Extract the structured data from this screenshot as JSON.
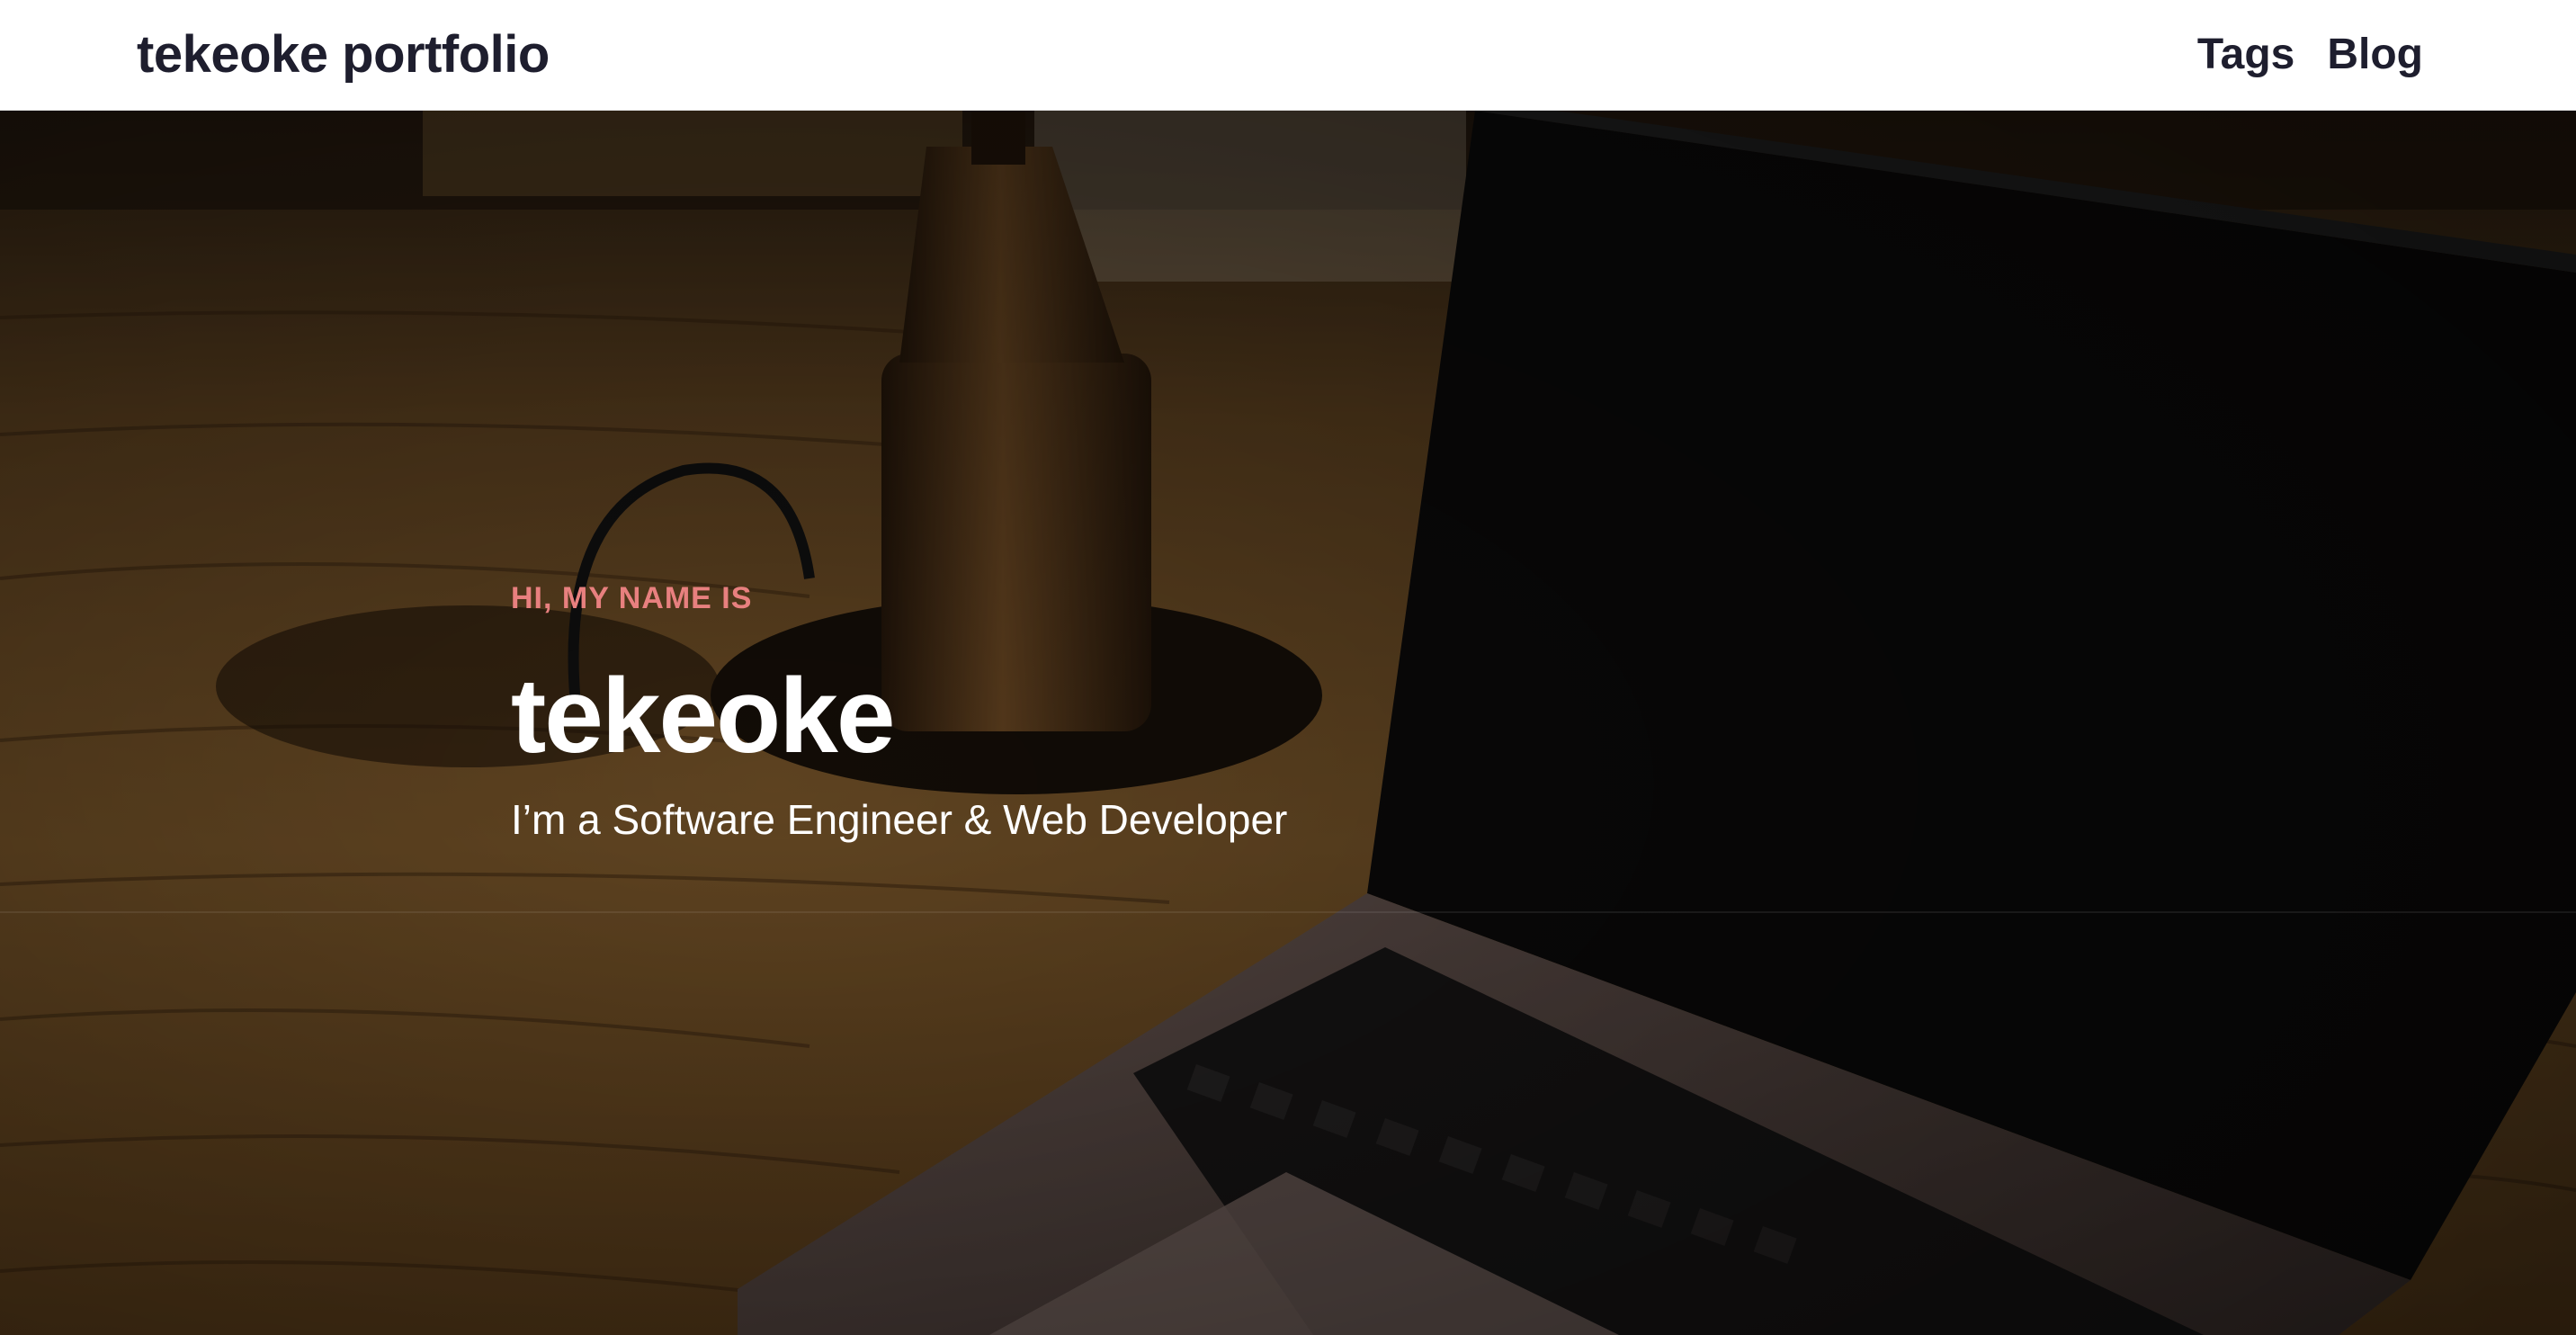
{
  "navbar": {
    "brand": "tekeoke portfolio",
    "links": [
      {
        "label": "Tags"
      },
      {
        "label": "Blog"
      }
    ]
  },
  "hero": {
    "eyebrow": "HI, MY NAME IS",
    "title": "tekeoke",
    "subtitle": "I’m a Software Engineer & Web Developer",
    "background_image": "laptop-on-wooden-desk"
  },
  "colors": {
    "nav_text": "#1e1e2e",
    "eyebrow": "#e8807f",
    "hero_text": "#ffffff",
    "nav_background": "#ffffff"
  }
}
